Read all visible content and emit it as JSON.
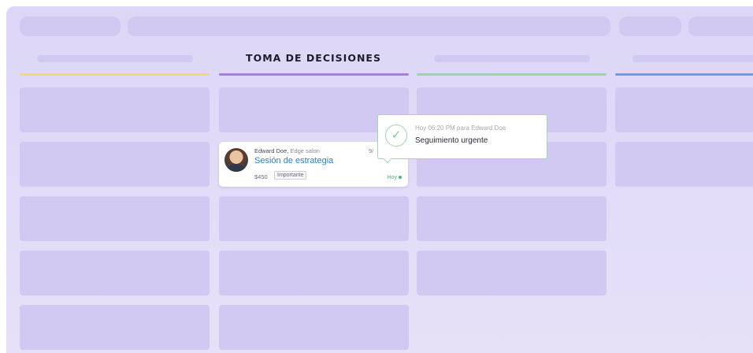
{
  "colors": {
    "background": "#ddd6f7",
    "placeholder": "#d1c9f1",
    "stage_1": "#eadb72",
    "stage_2": "#a87ce0",
    "stage_3": "#9dd89a",
    "stage_4": "#6a9de8",
    "link": "#2a7fd4",
    "success": "#4fb87a"
  },
  "pipeline": {
    "stages": [
      {
        "title": "",
        "color": "#eadb72"
      },
      {
        "title": "TOMA DE DECISIONES",
        "color": "#a87ce0"
      },
      {
        "title": "",
        "color": "#9dd89a"
      },
      {
        "title": "",
        "color": "#6a9de8"
      }
    ]
  },
  "deal": {
    "person": "Edward Doe,",
    "organization": "Edge salon",
    "date": "9/",
    "title": "Sesión de estrategia",
    "value": "$450",
    "tag": "Importante",
    "due": "Hoy",
    "avatar_icon": "person-avatar"
  },
  "activity_tooltip": {
    "icon": "check-circle-icon",
    "time": "Hoy 06:20 PM para Edward Doe",
    "note": "Seguimiento urgente"
  }
}
